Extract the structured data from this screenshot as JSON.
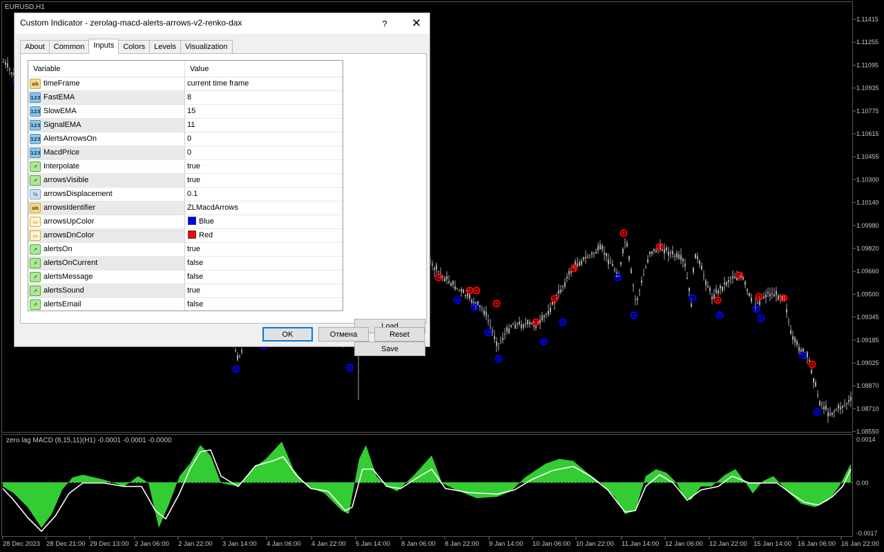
{
  "chart": {
    "symbol": "EURUSD,H1",
    "price_axis": [
      "1.11415",
      "1.11255",
      "1.11095",
      "1.10935",
      "1.10775",
      "1.10615",
      "1.10455",
      "1.10300",
      "1.10140",
      "1.09980",
      "1.09820",
      "1.09660",
      "1.09500",
      "1.09345",
      "1.09185",
      "1.09025",
      "1.08870",
      "1.08710",
      "1.08550"
    ],
    "indicator_label": "zero lag MACD (8,15,11)(H1) -0.0001 -0.0001 -0.0000",
    "indicator_axis": [
      "0.0014",
      "0.00",
      "-0.0017"
    ],
    "time_axis": [
      "28 Dec 2023",
      "28 Dec 21:00",
      "29 Dec 13:00",
      "2 Jan 06:00",
      "2 Jan 22:00",
      "3 Jan 14:00",
      "4 Jan 06:00",
      "4 Jan 22:00",
      "5 Jan 14:00",
      "8 Jan 06:00",
      "8 Jan 22:00",
      "9 Jan 14:00",
      "10 Jan 06:00",
      "10 Jan 22:00",
      "11 Jan 14:00",
      "12 Jan 06:00",
      "12 Jan 22:00",
      "15 Jan 14:00",
      "16 Jan 06:00",
      "16 Jan 22:00"
    ],
    "colors": {
      "candle": "#a8a8a8",
      "up_arrow": "#0000ff",
      "down_arrow": "#ff0000",
      "histogram": "#33cc33",
      "signal_line": "#ffffff",
      "grid": "#1e1e1e"
    }
  },
  "dialog": {
    "title": "Custom Indicator - zerolag-macd-alerts-arrows-v2-renko-dax",
    "help": "?",
    "close": "✕",
    "tabs": [
      "About",
      "Common",
      "Inputs",
      "Colors",
      "Levels",
      "Visualization"
    ],
    "active_tab": "Inputs",
    "table": {
      "header_variable": "Variable",
      "header_value": "Value",
      "rows": [
        {
          "type": "string",
          "variable": "timeFrame",
          "value": "current time frame"
        },
        {
          "type": "int",
          "variable": "FastEMA",
          "value": "8"
        },
        {
          "type": "int",
          "variable": "SlowEMA",
          "value": "15"
        },
        {
          "type": "int",
          "variable": "SignalEMA",
          "value": "11"
        },
        {
          "type": "int",
          "variable": "AlertsArrowsOn",
          "value": "0"
        },
        {
          "type": "int",
          "variable": "MacdPrice",
          "value": "0"
        },
        {
          "type": "bool",
          "variable": "Interpolate",
          "value": "true"
        },
        {
          "type": "bool",
          "variable": "arrowsVisible",
          "value": "true"
        },
        {
          "type": "double",
          "variable": "arrowsDisplacement",
          "value": "0.1"
        },
        {
          "type": "string",
          "variable": "arrowsIdentifier",
          "value": "ZLMacdArrows"
        },
        {
          "type": "color",
          "variable": "arrowsUpColor",
          "value": "Blue",
          "swatch": "#0000ff"
        },
        {
          "type": "color",
          "variable": "arrowsDnColor",
          "value": "Red",
          "swatch": "#ff0000"
        },
        {
          "type": "bool",
          "variable": "alertsOn",
          "value": "true"
        },
        {
          "type": "bool",
          "variable": "alertsOnCurrent",
          "value": "false"
        },
        {
          "type": "bool",
          "variable": "alertsMessage",
          "value": "false"
        },
        {
          "type": "bool",
          "variable": "alertsSound",
          "value": "true"
        },
        {
          "type": "bool",
          "variable": "alertsEmail",
          "value": "false"
        }
      ]
    },
    "buttons": {
      "load": "Load",
      "save": "Save",
      "ok": "OK",
      "cancel": "Отмена",
      "reset": "Reset"
    }
  }
}
